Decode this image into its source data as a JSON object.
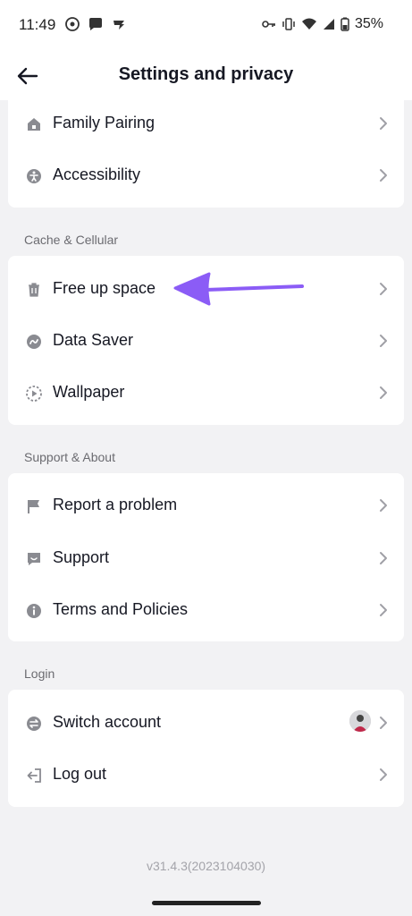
{
  "status": {
    "time": "11:49",
    "battery": "35%"
  },
  "header": {
    "title": "Settings and privacy",
    "back_icon": "arrow-left-icon"
  },
  "sections": {
    "account_group": {
      "items": [
        {
          "label": "Family Pairing",
          "icon": "home-icon"
        },
        {
          "label": "Accessibility",
          "icon": "accessibility-icon"
        }
      ]
    },
    "cache": {
      "title": "Cache & Cellular",
      "items": [
        {
          "label": "Free up space",
          "icon": "trash-icon"
        },
        {
          "label": "Data Saver",
          "icon": "data-saver-icon"
        },
        {
          "label": "Wallpaper",
          "icon": "wallpaper-icon"
        }
      ]
    },
    "support": {
      "title": "Support & About",
      "items": [
        {
          "label": "Report a problem",
          "icon": "flag-icon"
        },
        {
          "label": "Support",
          "icon": "chat-icon"
        },
        {
          "label": "Terms and Policies",
          "icon": "info-icon"
        }
      ]
    },
    "login": {
      "title": "Login",
      "items": [
        {
          "label": "Switch account",
          "icon": "switch-icon"
        },
        {
          "label": "Log out",
          "icon": "logout-icon"
        }
      ]
    }
  },
  "footer": {
    "version": "v31.4.3(2023104030)"
  },
  "colors": {
    "background": "#f2f2f4",
    "card": "#ffffff",
    "icon": "#8a8b91",
    "arrow_accent": "#8b5cf6"
  }
}
